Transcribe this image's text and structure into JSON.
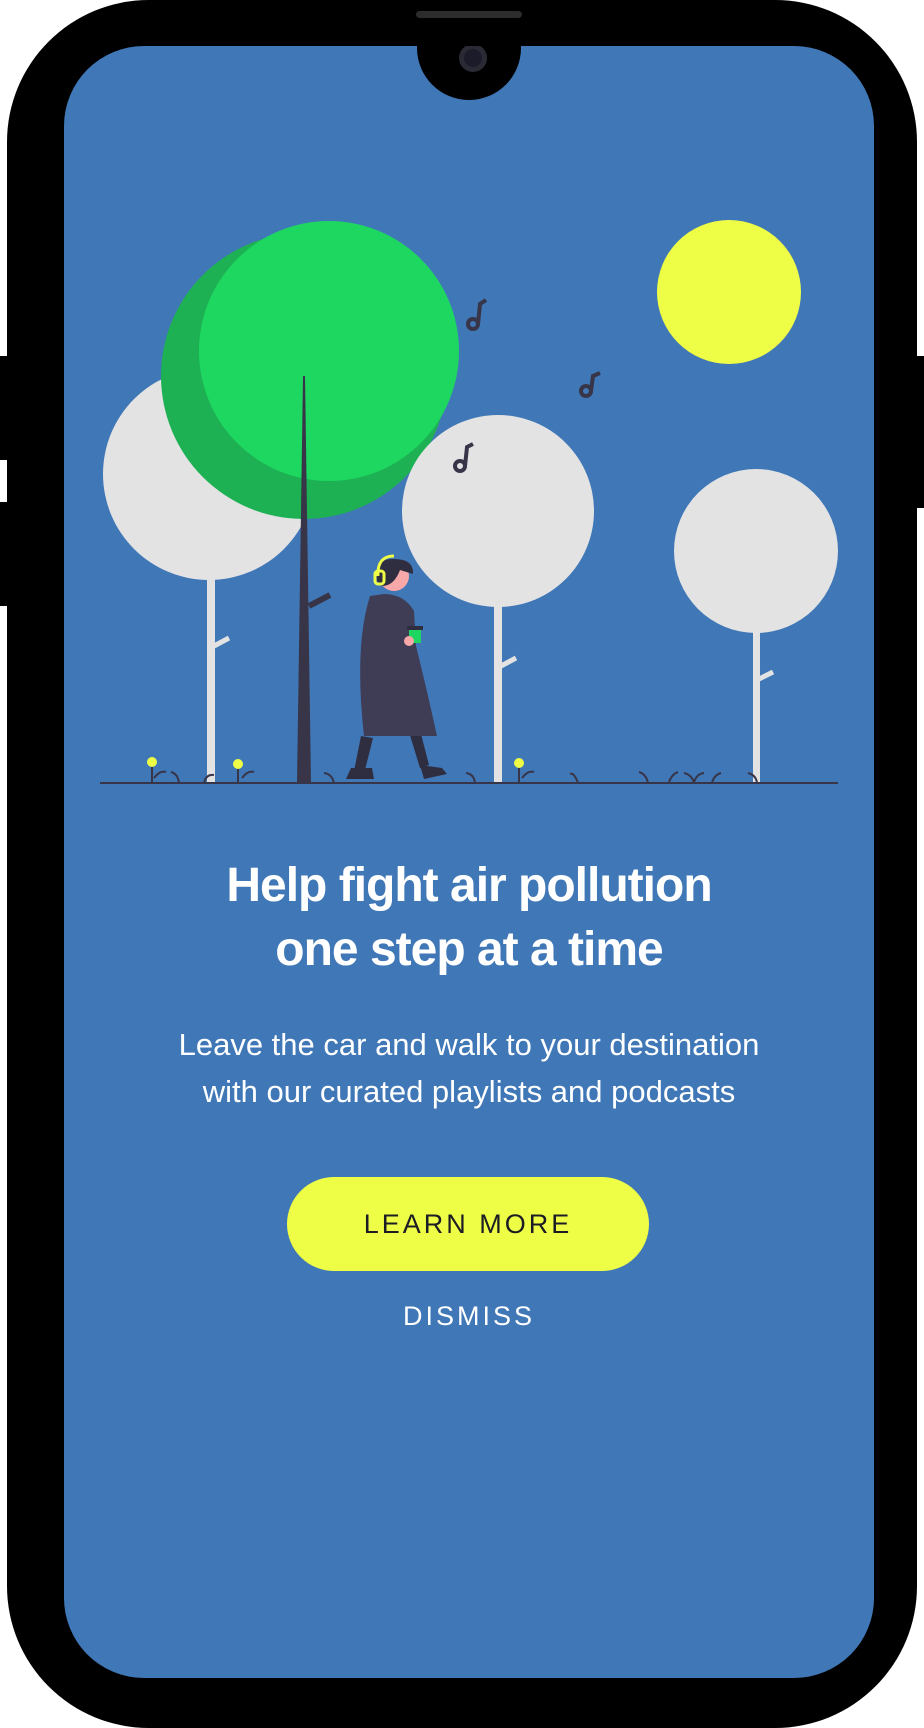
{
  "screen": {
    "background_color": "#4077b7"
  },
  "illustration": {
    "icons": [
      "sun-icon",
      "music-note-icon",
      "tree-icon",
      "person-walking-icon",
      "headphones-icon",
      "flower-icon"
    ],
    "colors": {
      "sun": "#eefe47",
      "big_tree_light": "#1ed760",
      "big_tree_dark": "#1db154",
      "white_tree": "#e3e3e3",
      "ink": "#373547"
    }
  },
  "content": {
    "headline_line1": "Help fight air pollution",
    "headline_line2": "one step at a time",
    "body_line1": "Leave the car and walk to your destination",
    "body_line2": "with our curated playlists and podcasts"
  },
  "actions": {
    "learn_more_label": "LEARN MORE",
    "dismiss_label": "DISMISS",
    "accent_color": "#eefe47"
  }
}
